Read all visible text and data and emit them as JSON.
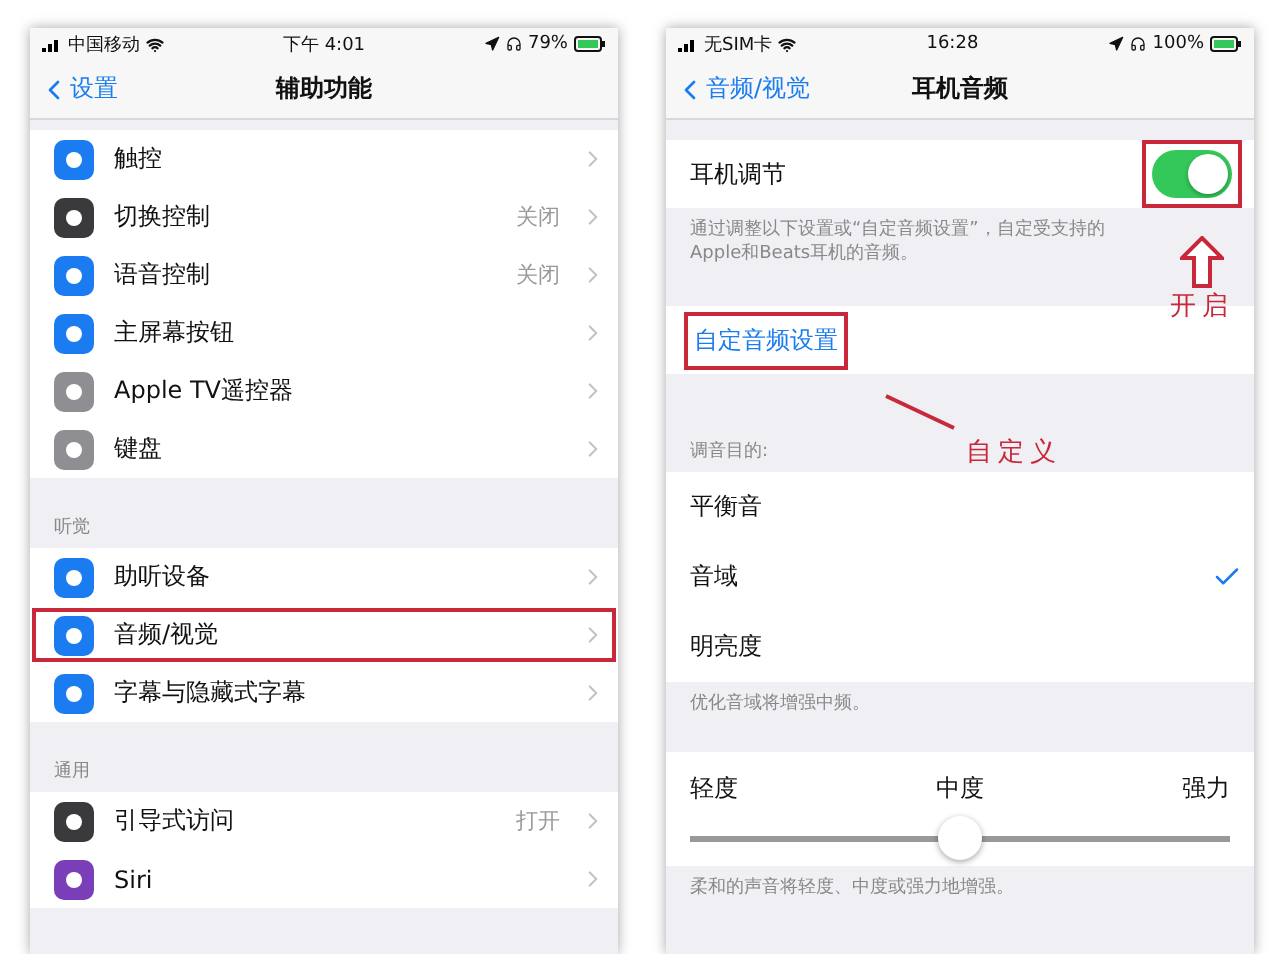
{
  "left_screen": {
    "status_bar": {
      "carrier": "中国移动",
      "time": "下午 4:01",
      "battery": "79%"
    },
    "nav": {
      "back": "设置",
      "title": "辅助功能"
    },
    "sections": [
      {
        "rows": [
          {
            "label": "触控",
            "detail": null,
            "color": "#1a7cf0",
            "highlighted": false
          },
          {
            "label": "切换控制",
            "detail": "关闭",
            "color": "#3a3a3c",
            "highlighted": false
          },
          {
            "label": "语音控制",
            "detail": "关闭",
            "color": "#1a7cf0",
            "highlighted": false
          },
          {
            "label": "主屏幕按钮",
            "detail": null,
            "color": "#1a7cf0",
            "highlighted": false
          },
          {
            "label": "Apple TV遥控器",
            "detail": null,
            "color": "#8e8e93",
            "highlighted": false
          },
          {
            "label": "键盘",
            "detail": null,
            "color": "#8e8e93",
            "highlighted": false
          }
        ]
      },
      {
        "header": "听觉",
        "rows": [
          {
            "label": "助听设备",
            "detail": null,
            "color": "#1a7cf0",
            "highlighted": false
          },
          {
            "label": "音频/视觉",
            "detail": null,
            "color": "#1a7cf0",
            "highlighted": true
          },
          {
            "label": "字幕与隐藏式字幕",
            "detail": null,
            "color": "#1a7cf0",
            "highlighted": false
          }
        ]
      },
      {
        "header": "通用",
        "rows": [
          {
            "label": "引导式访问",
            "detail": "打开",
            "color": "#3a3a3c",
            "highlighted": false
          },
          {
            "label": "Siri",
            "detail": null,
            "color": "#7a3fb8",
            "highlighted": false
          }
        ]
      }
    ]
  },
  "right_screen": {
    "status_bar": {
      "carrier": "无SIM卡",
      "time": "16:28",
      "battery": "100%"
    },
    "nav": {
      "back": "音频/视觉",
      "title": "耳机音频"
    },
    "toggle_row": {
      "label": "耳机调节",
      "on": true,
      "highlighted": true
    },
    "toggle_footer": "通过调整以下设置或“自定音频设置”，自定受支持的Apple和Beats耳机的音频。",
    "custom_link": {
      "label": "自定音频设置",
      "highlighted": true
    },
    "tuning_header": "调音目的:",
    "tuning_options": [
      {
        "label": "平衡音",
        "selected": false
      },
      {
        "label": "音域",
        "selected": true
      },
      {
        "label": "明亮度",
        "selected": false
      }
    ],
    "tuning_footer": "优化音域将增强中频。",
    "strength": {
      "labels": [
        "轻度",
        "中度",
        "强力"
      ],
      "level": 0.5
    },
    "strength_footer": "柔和的声音将轻度、中度或强力地增强。",
    "annotations": [
      {
        "kind": "arrow-label",
        "text": "开启"
      },
      {
        "kind": "line-label",
        "text": "自定义"
      }
    ]
  }
}
